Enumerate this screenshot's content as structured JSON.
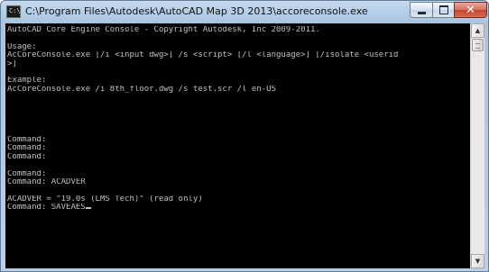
{
  "window": {
    "title": "C:\\Program Files\\Autodesk\\AutoCAD Map 3D 2013\\accoreconsole.exe",
    "icon": "console-icon",
    "controls": {
      "minimize_icon": "minimize-icon",
      "maximize_icon": "maximize-icon",
      "close_icon": "close-icon",
      "close_glyph": "✕"
    }
  },
  "console": {
    "lines": [
      "AutoCAD Core Engine Console - Copyright Autodesk, Inc 2009-2011.",
      "",
      "Usage:",
      "AcCoreConsole.exe [/i <input dwg>] /s <script> [/l <language>] [/isolate <userid",
      ">]",
      "",
      "Example:",
      "AcCoreConsole.exe /i 8th_floor.dwg /s test.scr /l en-US",
      "",
      "",
      "",
      "",
      "",
      "Command:",
      "Command:",
      "Command:",
      "",
      "Command:",
      "Command: ACADVER",
      "",
      "ACADVER = \"19.0s (LMS Tech)\" (read only)",
      "Command: SAVEAES"
    ],
    "text_color": "#c0c0c0",
    "background_color": "#000000"
  },
  "scrollbar": {
    "up_glyph": "▲",
    "down_glyph": "▼"
  },
  "colors": {
    "title_bar": "#b4cde6",
    "close_button": "#c1452c"
  }
}
